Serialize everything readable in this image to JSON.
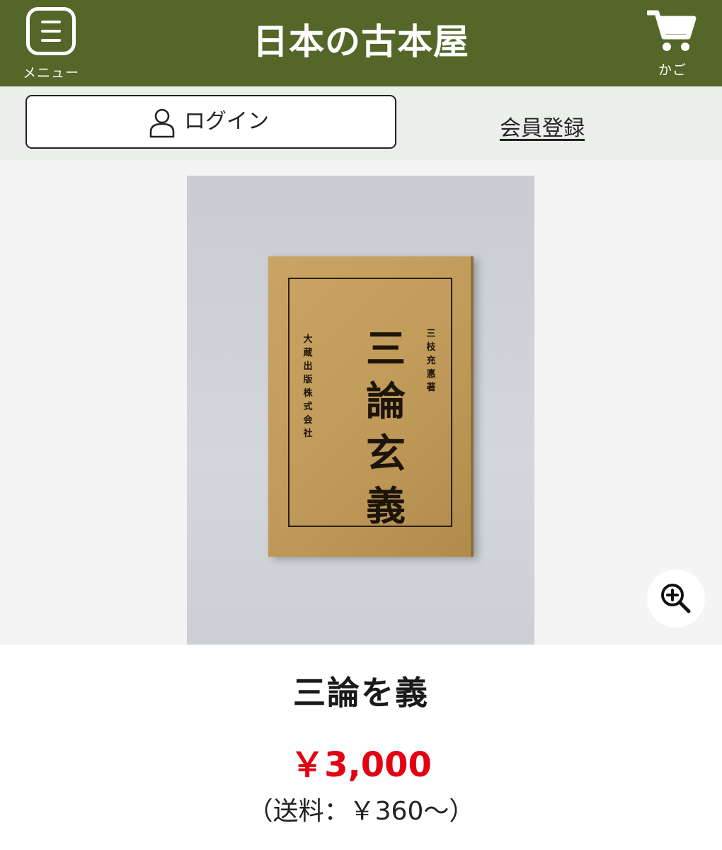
{
  "header": {
    "menu_label": "メニュー",
    "logo_text": "日本の古本屋",
    "cart_label": "かご"
  },
  "auth": {
    "login_label": "ログイン",
    "register_label": "会員登録"
  },
  "product": {
    "cover": {
      "title": "三論玄義",
      "author": "三枝充悳著",
      "publisher": "大蔵出版株式会社"
    },
    "title": "三論を義",
    "price": "￥3,000",
    "shipping": "（送料：￥360～）"
  },
  "colors": {
    "header_bg": "#546628",
    "auth_bg": "#ebeeea",
    "price": "#e30012"
  },
  "icons": [
    "menu-icon",
    "cart-icon",
    "user-icon",
    "zoom-in-icon"
  ]
}
